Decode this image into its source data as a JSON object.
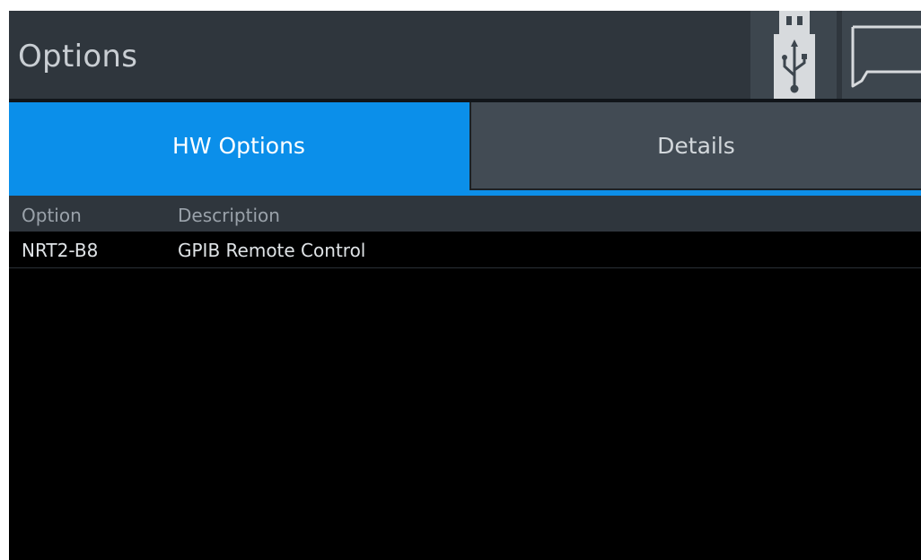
{
  "title_bar": {
    "title": "Options",
    "usb_icon": "usb-icon",
    "message_icon": "message-icon"
  },
  "tabs": [
    {
      "label": "HW Options",
      "active": true
    },
    {
      "label": "Details",
      "active": false
    }
  ],
  "table": {
    "columns": [
      "Option",
      "Description"
    ],
    "rows": [
      {
        "option": "NRT2-B8",
        "description": "GPIB Remote Control"
      }
    ]
  },
  "colors": {
    "active_tab": "#0b8fea",
    "inactive_tab": "#424b54",
    "title_bar": "#2f363d",
    "background": "#000000"
  }
}
